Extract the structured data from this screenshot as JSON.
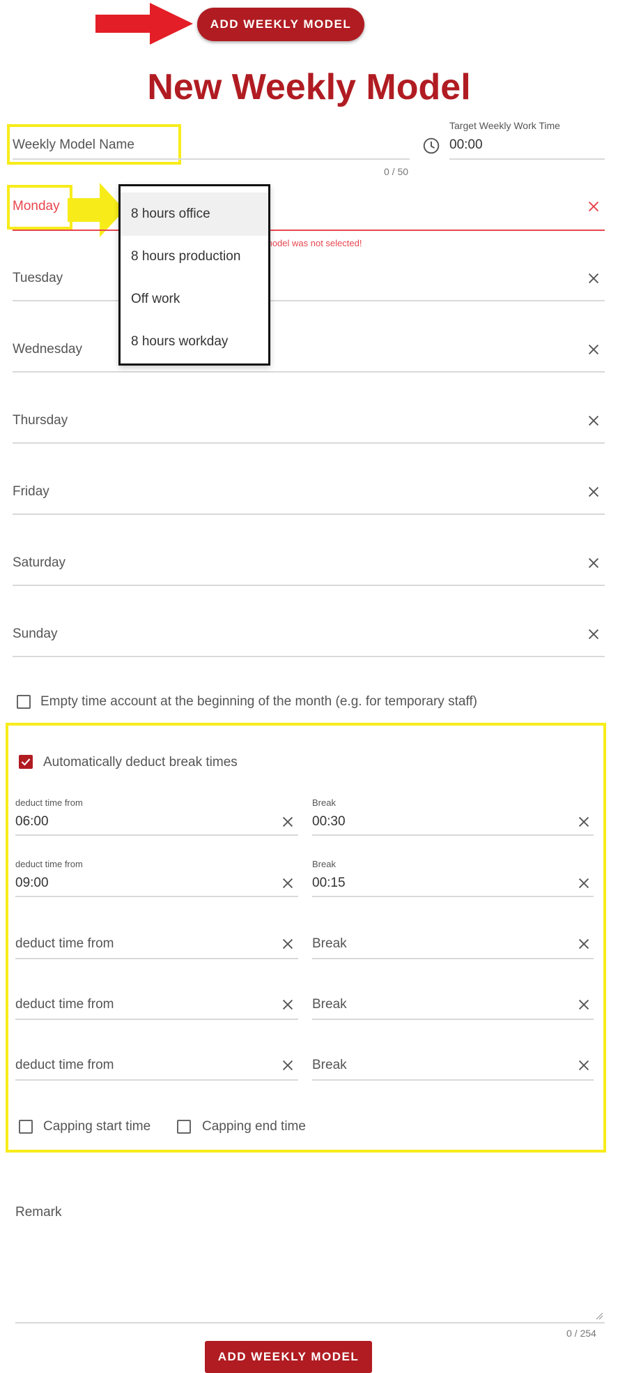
{
  "top_button": {
    "label": "ADD WEEKLY MODEL"
  },
  "title": "New Weekly Model",
  "name_field": {
    "label": "Weekly Model Name",
    "counter": "0 / 50"
  },
  "target_field": {
    "label": "Target Weekly Work Time",
    "value": "00:00",
    "icon": "clock-icon"
  },
  "days": {
    "monday": "Monday",
    "tuesday": "Tuesday",
    "wednesday": "Wednesday",
    "thursday": "Thursday",
    "friday": "Friday",
    "saturday": "Saturday",
    "sunday": "Sunday"
  },
  "monday_error": "model was not selected!",
  "dropdown": {
    "options": [
      "8 hours office",
      "8 hours production",
      "Off work",
      "8 hours workday"
    ],
    "selected": "8 hours office"
  },
  "empty_account_checkbox": {
    "label": "Empty time account at the beginning of the month (e.g. for temporary staff)",
    "checked": false
  },
  "break_section": {
    "auto_deduct": {
      "label": "Automatically deduct break times",
      "checked": true
    },
    "rows": [
      {
        "from_label": "deduct time from",
        "from_value": "06:00",
        "break_label": "Break",
        "break_value": "00:30"
      },
      {
        "from_label": "deduct time from",
        "from_value": "09:00",
        "break_label": "Break",
        "break_value": "00:15"
      },
      {
        "from_label": "deduct time from",
        "from_value": "",
        "break_label": "Break",
        "break_value": ""
      },
      {
        "from_label": "deduct time from",
        "from_value": "",
        "break_label": "Break",
        "break_value": ""
      },
      {
        "from_label": "deduct time from",
        "from_value": "",
        "break_label": "Break",
        "break_value": ""
      }
    ],
    "capping_start": {
      "label": "Capping start time",
      "checked": false
    },
    "capping_end": {
      "label": "Capping end time",
      "checked": false
    }
  },
  "remark": {
    "label": "Remark",
    "counter": "0 / 254"
  },
  "bottom_button": {
    "label": "ADD WEEKLY MODEL"
  },
  "colors": {
    "accent": "#b01c22",
    "highlight": "#f7ec1a",
    "error": "#e8474f"
  }
}
